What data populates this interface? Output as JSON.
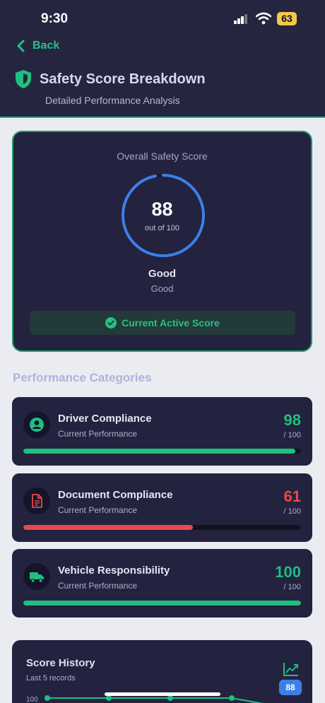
{
  "status": {
    "time": "9:30",
    "battery": "63"
  },
  "nav": {
    "back_label": "Back"
  },
  "header": {
    "title": "Safety Score Breakdown",
    "subtitle": "Detailed Performance Analysis"
  },
  "overall": {
    "label": "Overall Safety Score",
    "score": "88",
    "out_of": "out of 100",
    "score_fraction": 0.88,
    "grade": "Good",
    "grade_sub": "Good",
    "active_label": "Current Active Score"
  },
  "categories_title": "Performance Categories",
  "categories": [
    {
      "name": "Driver Compliance",
      "sub": "Current Performance",
      "value": "98",
      "max": "/ 100",
      "fraction": 0.98,
      "color": "#1fbf7f",
      "icon": "person-icon"
    },
    {
      "name": "Document Compliance",
      "sub": "Current Performance",
      "value": "61",
      "max": "/ 100",
      "fraction": 0.61,
      "color": "#e84a4a",
      "icon": "document-icon"
    },
    {
      "name": "Vehicle Responsibility",
      "sub": "Current Performance",
      "value": "100",
      "max": "/ 100",
      "fraction": 1.0,
      "color": "#1fbf7f",
      "icon": "truck-icon"
    }
  ],
  "history": {
    "title": "Score History",
    "subtitle": "Last 5 records",
    "latest_badge": "88",
    "axis_top": "100",
    "points": [
      100,
      100,
      100,
      100,
      88
    ]
  },
  "colors": {
    "accent": "#1fbf7f",
    "danger": "#e84a4a",
    "ring": "#3d7fe8",
    "card": "#23223f"
  }
}
